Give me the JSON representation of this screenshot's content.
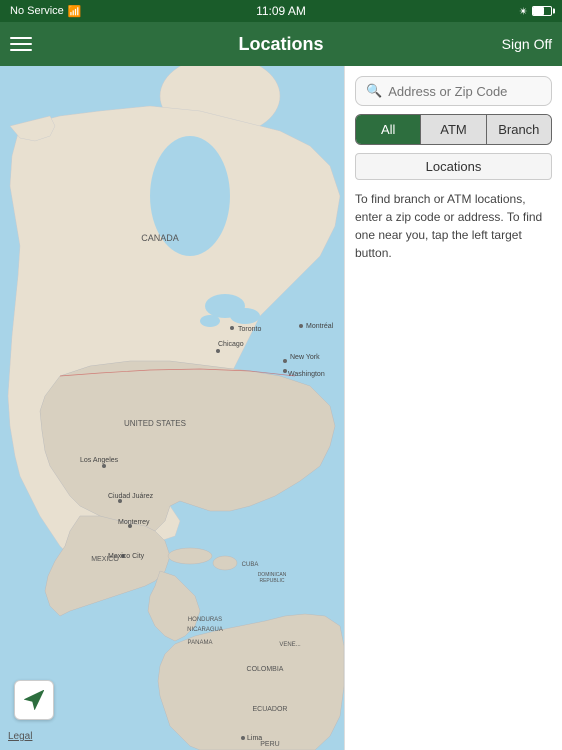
{
  "statusBar": {
    "signal": "No Service",
    "wifi": "📶",
    "time": "11:09 AM",
    "bluetooth": "🔵"
  },
  "navBar": {
    "menuLabel": "menu",
    "title": "Locations",
    "signOnLabel": "Sign Off"
  },
  "rightPanel": {
    "searchPlaceholder": "Address or Zip Code",
    "filterButtons": [
      {
        "label": "All",
        "state": "active"
      },
      {
        "label": "ATM",
        "state": "inactive"
      },
      {
        "label": "Branch",
        "state": "inactive"
      }
    ],
    "locationsTabLabel": "Locations",
    "infoText": "To find branch or ATM locations, enter a zip code or address. To find one near you, tap the left target button."
  },
  "map": {
    "locationButtonLabel": "locate-me"
  },
  "legal": {
    "linkLabel": "Legal"
  }
}
